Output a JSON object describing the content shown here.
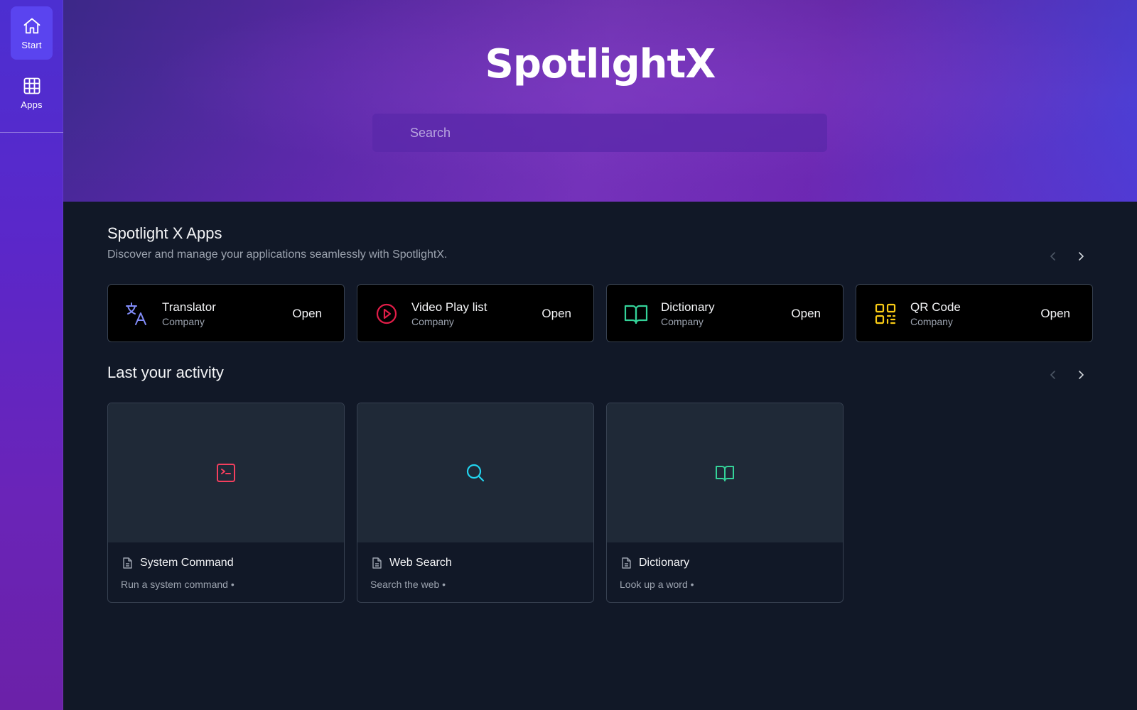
{
  "sidebar": {
    "items": [
      {
        "label": "Start",
        "icon": "home-icon",
        "active": true
      },
      {
        "label": "Apps",
        "icon": "grid-icon",
        "active": false
      }
    ]
  },
  "hero": {
    "logo_text": "Spotlight",
    "logo_mark": "X",
    "search_placeholder": "Search"
  },
  "apps_section": {
    "title": "Spotlight X Apps",
    "subtitle": "Discover and manage your applications seamlessly with SpotlightX.",
    "items": [
      {
        "name": "Translator",
        "company": "Company",
        "action": "Open",
        "icon": "translate-icon",
        "color": "#818cf8"
      },
      {
        "name": "Video Play list",
        "company": "Company",
        "action": "Open",
        "icon": "play-circle-icon",
        "color": "#e11d48"
      },
      {
        "name": "Dictionary",
        "company": "Company",
        "action": "Open",
        "icon": "book-icon",
        "color": "#34d399"
      },
      {
        "name": "QR Code",
        "company": "Company",
        "action": "Open",
        "icon": "qr-code-icon",
        "color": "#facc15"
      }
    ]
  },
  "activity_section": {
    "title": "Last your activity",
    "items": [
      {
        "title": "System Command",
        "desc": "Run a system command •",
        "icon": "terminal-icon",
        "color": "#f43f5e"
      },
      {
        "title": "Web Search",
        "desc": "Search the web •",
        "icon": "search-icon",
        "color": "#22d3ee"
      },
      {
        "title": "Dictionary",
        "desc": "Look up a word •",
        "icon": "book-icon",
        "color": "#34d399"
      }
    ]
  },
  "colors": {
    "sidebar_active": "#5a44ef",
    "background": "#111827",
    "card_border": "#374151"
  }
}
